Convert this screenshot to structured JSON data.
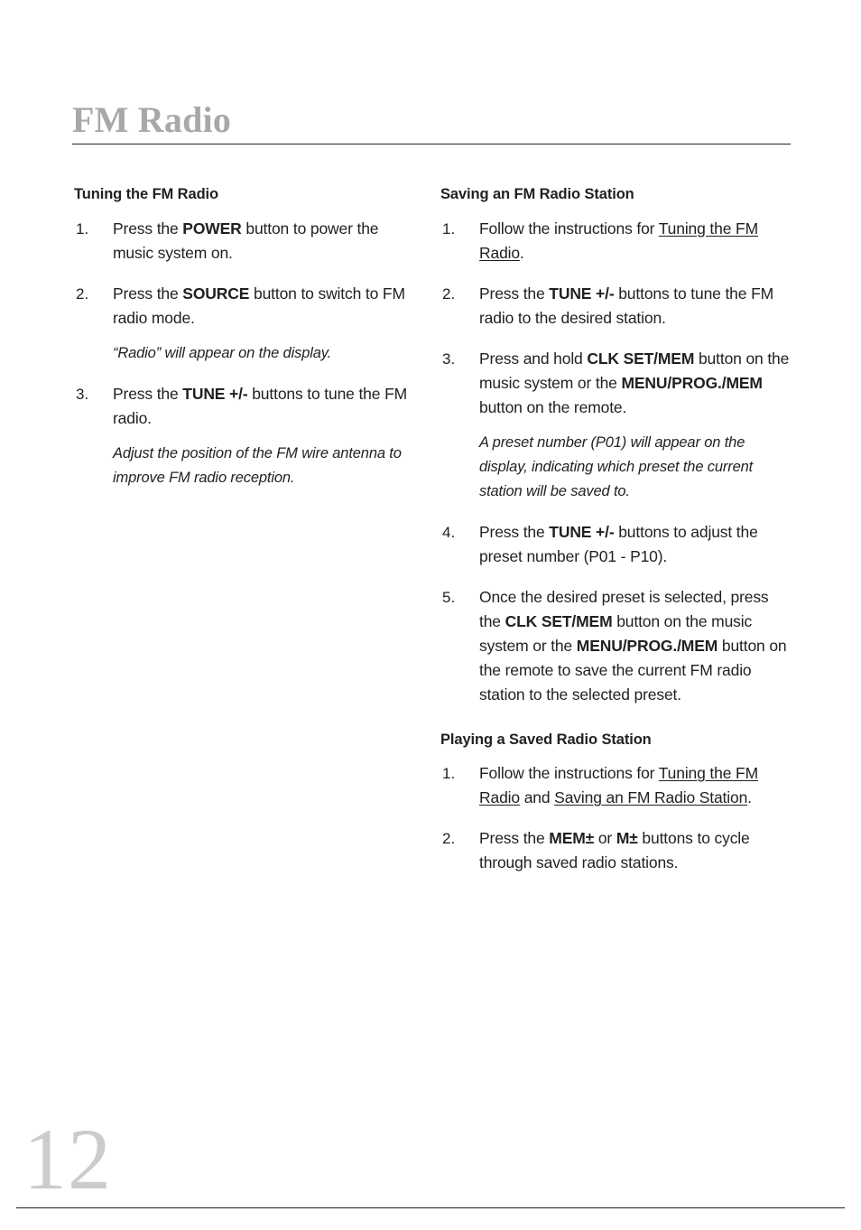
{
  "page": {
    "chapter_title": "FM Radio",
    "page_number": "12",
    "text_color": "#231f20",
    "title_color": "#a8a8a8",
    "page_number_color": "#cccccc"
  },
  "left_column": {
    "heading": "Tuning the FM Radio",
    "steps": [
      {
        "number": "1.",
        "parts": [
          {
            "text": "Press the ",
            "style": "normal"
          },
          {
            "text": "POWER",
            "style": "bold"
          },
          {
            "text": " button to power the music system on.",
            "style": "normal"
          }
        ]
      },
      {
        "number": "2.",
        "parts": [
          {
            "text": "Press the ",
            "style": "normal"
          },
          {
            "text": "SOURCE",
            "style": "bold"
          },
          {
            "text": " button to switch to FM radio mode.",
            "style": "normal"
          }
        ],
        "note": "“Radio” will appear on the display."
      },
      {
        "number": "3.",
        "parts": [
          {
            "text": "Press the ",
            "style": "normal"
          },
          {
            "text": "TUNE +/-",
            "style": "bold"
          },
          {
            "text": " buttons to tune the FM radio.",
            "style": "normal"
          }
        ],
        "note": "Adjust the position of the FM wire antenna to improve FM radio reception."
      }
    ]
  },
  "right_column": {
    "section_saving": {
      "heading": "Saving an FM Radio Station",
      "steps": [
        {
          "number": "1.",
          "parts": [
            {
              "text": "Follow the instructions for ",
              "style": "normal"
            },
            {
              "text": "Tuning the FM Radio",
              "style": "xref"
            },
            {
              "text": ".",
              "style": "normal"
            }
          ]
        },
        {
          "number": "2.",
          "parts": [
            {
              "text": "Press the ",
              "style": "normal"
            },
            {
              "text": "TUNE +/-",
              "style": "bold"
            },
            {
              "text": " buttons to tune the FM radio to the desired station.",
              "style": "normal"
            }
          ]
        },
        {
          "number": "3.",
          "parts": [
            {
              "text": "Press and hold ",
              "style": "normal"
            },
            {
              "text": "CLK SET/MEM",
              "style": "bold"
            },
            {
              "text": " button on the music system or the ",
              "style": "normal"
            },
            {
              "text": "MENU/PROG./MEM",
              "style": "bold"
            },
            {
              "text": " button on the remote.",
              "style": "normal"
            }
          ],
          "note": "A preset number (P01) will appear on the display, indicating which preset the current station will be saved to."
        },
        {
          "number": "4.",
          "parts": [
            {
              "text": "Press the ",
              "style": "normal"
            },
            {
              "text": "TUNE +/-",
              "style": "bold"
            },
            {
              "text": " buttons to adjust the preset number (P01 - P10).",
              "style": "normal"
            }
          ]
        },
        {
          "number": "5.",
          "parts": [
            {
              "text": "Once the desired preset is selected, press the ",
              "style": "normal"
            },
            {
              "text": "CLK SET/MEM",
              "style": "bold"
            },
            {
              "text": " button on the music system or the ",
              "style": "normal"
            },
            {
              "text": "MENU/PROG./MEM",
              "style": "bold"
            },
            {
              "text": " button on the remote to save the current FM radio station to the selected preset.",
              "style": "normal"
            }
          ]
        }
      ]
    },
    "section_playing": {
      "heading": "Playing a Saved Radio Station",
      "steps": [
        {
          "number": "1.",
          "parts": [
            {
              "text": "Follow the instructions for ",
              "style": "normal"
            },
            {
              "text": "Tuning the FM Radio",
              "style": "xref"
            },
            {
              "text": " and ",
              "style": "normal"
            },
            {
              "text": "Saving an FM Radio Station",
              "style": "xref"
            },
            {
              "text": ".",
              "style": "normal"
            }
          ]
        },
        {
          "number": "2.",
          "parts": [
            {
              "text": "Press the ",
              "style": "normal"
            },
            {
              "text": "MEM±",
              "style": "bold"
            },
            {
              "text": " or ",
              "style": "normal"
            },
            {
              "text": "M±",
              "style": "bold"
            },
            {
              "text": " buttons to cycle through saved radio stations.",
              "style": "normal"
            }
          ]
        }
      ]
    }
  }
}
